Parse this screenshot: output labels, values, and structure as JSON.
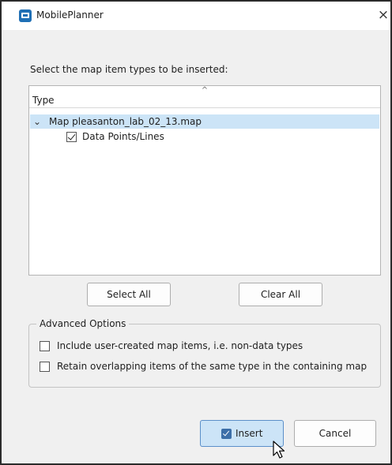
{
  "window": {
    "title": "MobilePlanner",
    "close_glyph": "×",
    "icon": "mobileplanner-app-icon"
  },
  "instruction": "Select the map item types to be inserted:",
  "tree": {
    "sort_indicator": "^",
    "column_header": "Type",
    "expander_glyph": "⌄",
    "map_item": {
      "label": "Map pleasanton_lab_02_13.map",
      "expanded": true,
      "selected": true
    },
    "child_item": {
      "label": "Data Points/Lines",
      "checked": true
    }
  },
  "buttons": {
    "select_all": "Select All",
    "clear_all": "Clear All",
    "insert": "Insert",
    "cancel": "Cancel"
  },
  "advanced": {
    "legend": "Advanced Options",
    "options": [
      {
        "label": "Include user-created map items, i.e. non-data types",
        "checked": false
      },
      {
        "label": "Retain overlapping items of the same type in the containing map",
        "checked": false
      }
    ]
  },
  "colors": {
    "selection": "#cce4f7",
    "accent": "#3d6fa8",
    "dialog_bg": "#f0f0f0"
  }
}
